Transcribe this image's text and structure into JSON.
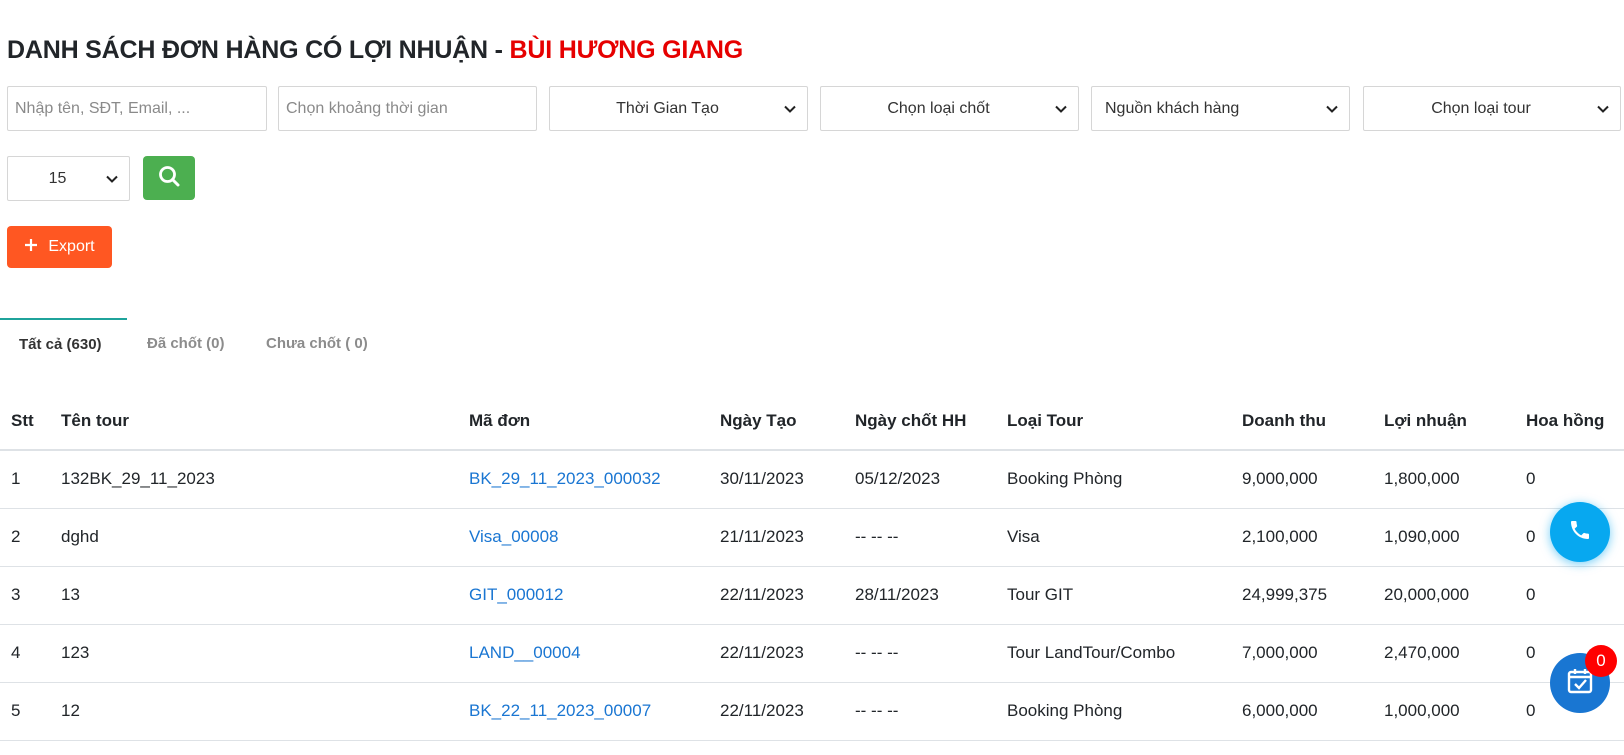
{
  "header": {
    "title_prefix": "DANH SÁCH ĐƠN HÀNG CÓ LỢI NHUẬN - ",
    "title_name": "BÙI HƯƠNG GIANG"
  },
  "filters": {
    "search_placeholder": "Nhập tên, SĐT, Email, ...",
    "date_range_placeholder": "Chọn khoảng thời gian",
    "time_type": "Thời Gian Tạo",
    "close_type": "Chọn loại chốt",
    "customer_source": "Nguồn khách hàng",
    "tour_type": "Chọn loại tour",
    "per_page": "15"
  },
  "actions": {
    "export_label": "Export"
  },
  "tabs": [
    {
      "label": "Tất cả (630)",
      "active": true
    },
    {
      "label": "Đã chốt (0)",
      "active": false
    },
    {
      "label": "Chưa chốt ( 0)",
      "active": false
    }
  ],
  "table": {
    "headers": [
      "Stt",
      "Tên tour",
      "Mã đơn",
      "Ngày Tạo",
      "Ngày chốt HH",
      "Loại Tour",
      "Doanh thu",
      "Lợi nhuận",
      "Hoa hồng"
    ],
    "rows": [
      [
        "1",
        "132BK_29_11_2023",
        "BK_29_11_2023_000032",
        "30/11/2023",
        "05/12/2023",
        "Booking Phòng",
        "9,000,000",
        "1,800,000",
        "0"
      ],
      [
        "2",
        "dghd",
        "Visa_00008",
        "21/11/2023",
        "-- -- --",
        "Visa",
        "2,100,000",
        "1,090,000",
        "0"
      ],
      [
        "3",
        "13",
        "GIT_000012",
        "22/11/2023",
        "28/11/2023",
        "Tour GIT",
        "24,999,375",
        "20,000,000",
        "0"
      ],
      [
        "4",
        "123",
        "LAND__00004",
        "22/11/2023",
        "-- -- --",
        "Tour LandTour/Combo",
        "7,000,000",
        "2,470,000",
        "0"
      ],
      [
        "5",
        "12",
        "BK_22_11_2023_00007",
        "22/11/2023",
        "-- -- --",
        "Booking Phòng",
        "6,000,000",
        "1,000,000",
        "0"
      ]
    ]
  },
  "floating": {
    "calendar_badge": "0"
  },
  "colors": {
    "title_name": "#e60000",
    "search_button": "#4caf50",
    "export_button": "#ff5722",
    "link": "#1a76d2",
    "tab_indicator": "#1fa39b",
    "call_fab": "#07a8f0",
    "calendar_fab": "#1976d2",
    "badge": "#ff0000"
  }
}
